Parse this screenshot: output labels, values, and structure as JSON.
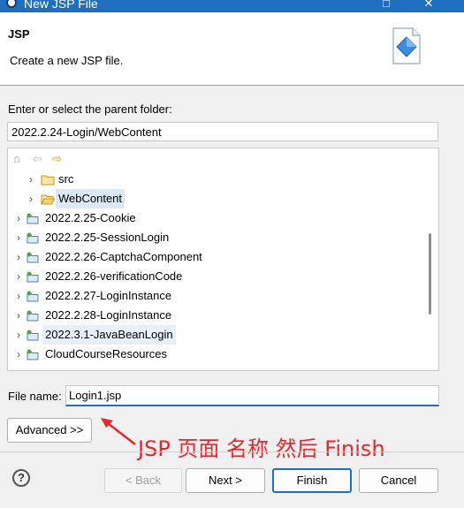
{
  "window": {
    "title": "New JSP File",
    "minimize": "—",
    "maximize": "□",
    "close": "✕"
  },
  "header": {
    "heading": "JSP",
    "description": "Create a new JSP file."
  },
  "parent_folder": {
    "label": "Enter or select the parent folder:",
    "value": "2022.2.24-Login/WebContent"
  },
  "tree": {
    "toolbar": {
      "home": "⌂",
      "back": "⇦",
      "forward": "⇨"
    },
    "items": [
      {
        "label": "src",
        "icon": "folder-icon",
        "expander": "›"
      },
      {
        "label": "WebContent",
        "icon": "folder-open-icon",
        "expander": "›"
      },
      {
        "label": "2022.2.25-Cookie",
        "icon": "project-icon",
        "expander": "›"
      },
      {
        "label": "2022.2.25-SessionLogin",
        "icon": "project-icon",
        "expander": "›"
      },
      {
        "label": "2022.2.26-CaptchaComponent",
        "icon": "project-icon",
        "expander": "›"
      },
      {
        "label": "2022.2.26-verificationCode",
        "icon": "project-icon",
        "expander": "›"
      },
      {
        "label": "2022.2.27-LoginInstance",
        "icon": "project-icon",
        "expander": "›"
      },
      {
        "label": "2022.2.28-LoginInstance",
        "icon": "project-icon",
        "expander": "›"
      },
      {
        "label": "2022.3.1-JavaBeanLogin",
        "icon": "project-icon",
        "expander": "›"
      },
      {
        "label": "CloudCourseResources",
        "icon": "project-icon",
        "expander": "›"
      }
    ]
  },
  "file_name": {
    "label": "File name:",
    "value": "Login1.jsp"
  },
  "buttons": {
    "advanced": "Advanced >>",
    "back": "< Back",
    "next": "Next >",
    "finish": "Finish",
    "cancel": "Cancel",
    "help": "?"
  },
  "annotation": "JSP 页面 名称 然后 Finish",
  "colors": {
    "accent": "#1f6fc0",
    "annotation": "#e8262b"
  }
}
